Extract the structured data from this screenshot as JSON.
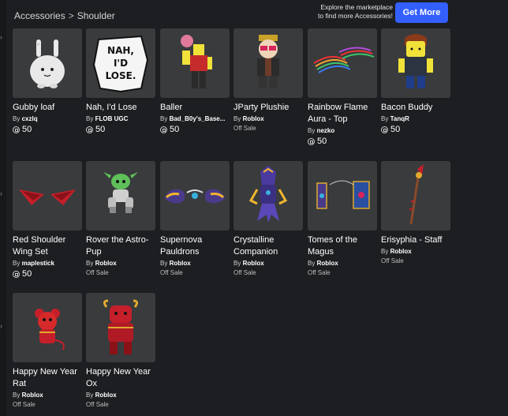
{
  "breadcrumb": {
    "items": [
      "Accessories",
      "Shoulder"
    ],
    "separator": ">"
  },
  "promo": {
    "text_line1": "Explore the marketplace",
    "text_line2": "to find more Accessories!",
    "button_label": "Get More"
  },
  "items": [
    {
      "name": "Gubby loaf",
      "by": "By",
      "creator": "cxzlq",
      "price": "50",
      "offsale": ""
    },
    {
      "name": "Nah, I'd Lose",
      "by": "By",
      "creator": "FLOB UGC",
      "price": "50",
      "offsale": ""
    },
    {
      "name": "Baller",
      "by": "By",
      "creator": "Bad_B0y's_Base...",
      "price": "50",
      "offsale": ""
    },
    {
      "name": "JParty Plushie",
      "by": "By",
      "creator": "Roblox",
      "price": "",
      "offsale": "Off Sale"
    },
    {
      "name": "Rainbow Flame Aura - Top",
      "by": "By",
      "creator": "nezko",
      "price": "50",
      "offsale": ""
    },
    {
      "name": "Bacon Buddy",
      "by": "By",
      "creator": "TanqR",
      "price": "50",
      "offsale": ""
    },
    {
      "name": "Red Shoulder Wing Set",
      "by": "By",
      "creator": "maplestick",
      "price": "50",
      "offsale": ""
    },
    {
      "name": "Rover the Astro-Pup",
      "by": "By",
      "creator": "Roblox",
      "price": "",
      "offsale": "Off Sale"
    },
    {
      "name": "Supernova Pauldrons",
      "by": "By",
      "creator": "Roblox",
      "price": "",
      "offsale": "Off Sale"
    },
    {
      "name": "Crystalline Companion",
      "by": "By",
      "creator": "Roblox",
      "price": "",
      "offsale": "Off Sale"
    },
    {
      "name": "Tomes of the Magus",
      "by": "By",
      "creator": "Roblox",
      "price": "",
      "offsale": "Off Sale"
    },
    {
      "name": "Erisyphia - Staff",
      "by": "By",
      "creator": "Roblox",
      "price": "",
      "offsale": "Off Sale"
    },
    {
      "name": "Happy New Year Rat",
      "by": "By",
      "creator": "Roblox",
      "price": "",
      "offsale": "Off Sale"
    },
    {
      "name": "Happy New Year Ox",
      "by": "By",
      "creator": "Roblox",
      "price": "",
      "offsale": "Off Sale"
    }
  ],
  "icons": {
    "robux": "robux-icon",
    "chevron": "chevron-right-icon"
  },
  "colors": {
    "background": "#1d1e21",
    "tile": "#393b3d",
    "accent": "#335fff"
  },
  "comic_text": {
    "line1": "NAH,",
    "line2": "I'D",
    "line3": "LOSE."
  }
}
